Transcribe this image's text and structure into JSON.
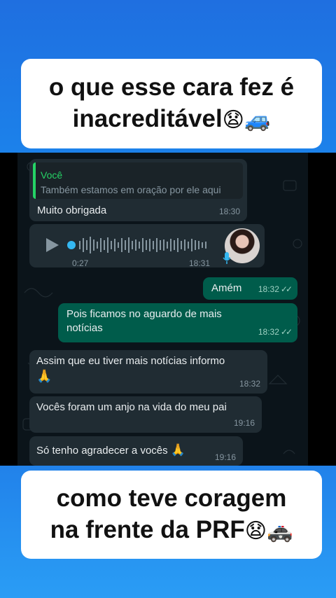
{
  "caption_top": {
    "line1": "o que esse cara fez é",
    "line2": "inacreditável",
    "emoji1": "😧",
    "emoji2": "🚙"
  },
  "caption_bottom": {
    "line1": "como teve coragem",
    "line2": "na frente da PRF",
    "emoji1": "😧",
    "emoji2": "🚓"
  },
  "chat": {
    "reply": {
      "quote_author": "Você",
      "quote_text": "Também estamos em oração por ele aqui",
      "text": "Muito obrigada",
      "time": "18:30"
    },
    "voice": {
      "duration": "0:27",
      "time": "18:31"
    },
    "messages": [
      {
        "text": "Amém",
        "time": "18:32",
        "direction": "out"
      },
      {
        "text": "Pois ficamos no aguardo de mais notícias",
        "time": "18:32",
        "direction": "out"
      },
      {
        "text": "Assim que eu tiver mais notícias informo",
        "emoji": "🙏",
        "time": "18:32",
        "direction": "in"
      },
      {
        "text": "Vocês foram um anjo na vida do meu pai",
        "time": "19:16",
        "direction": "in"
      },
      {
        "text": "Só tenho agradecer a vocês",
        "emoji": "🙏",
        "time": "19:16",
        "direction": "in"
      }
    ],
    "colors": {
      "incoming": "#202c33",
      "outgoing": "#005c4b",
      "background": "#0b141a",
      "quote_bar": "#25d366",
      "quote_author": "#25d366"
    }
  }
}
